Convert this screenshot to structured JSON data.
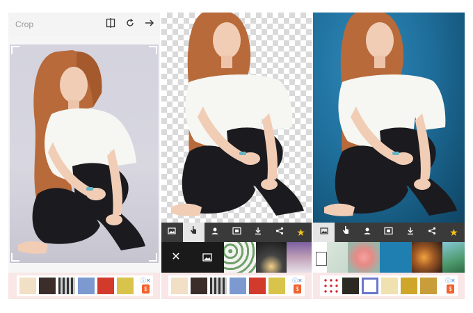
{
  "panel1": {
    "title": "Crop",
    "icons": [
      "compare-icon",
      "rotate-icon",
      "next-arrow-icon"
    ]
  },
  "toolbar": {
    "tools": [
      "image-icon",
      "hand-touch-icon",
      "person-icon",
      "aspect-icon",
      "download-icon",
      "share-icon",
      "star-icon"
    ]
  },
  "panel2": {
    "close_label": "✕",
    "gallery_icon": "gallery-icon"
  },
  "colors": {
    "toolbar_bg": "#3a3a3a",
    "active_tool_bg": "#e6e6e6",
    "star": "#f5c518",
    "ad_bg": "#f9e6e6",
    "blue_background": "#1f6f9c"
  },
  "ads": {
    "info_label": "ⓘ✕",
    "bag_label": "$"
  }
}
